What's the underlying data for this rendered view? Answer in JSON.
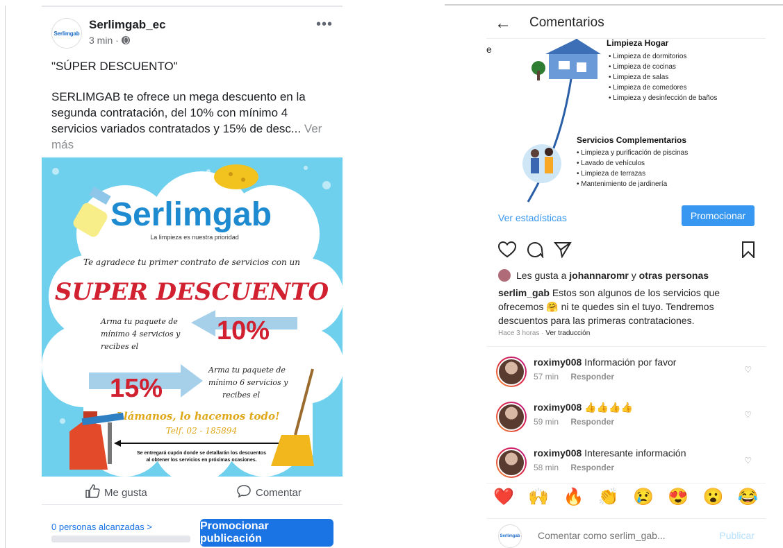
{
  "facebook": {
    "page_name": "Serlimgab_ec",
    "avatar_text": "Serlimgab",
    "time": "3 min ·",
    "more_label": "•••",
    "title": "\"SÚPER DESCUENTO\"",
    "body": "SERLIMGAB te ofrece un mega descuento en la segunda contratación, del 10% con mínimo 4 servicios variados contratados y 15% de desc...",
    "see_more": "Ver más",
    "image": {
      "brand": "Serlimgab",
      "tagline": "La limpieza es nuestra prioridad",
      "thanks": "Te agradece tu primer contrato de servicios con un",
      "headline": "SUPER DESCUENTO",
      "pack1": "Arma tu paquete de mínimo 4 servicios y recibes el",
      "pct1": "10%",
      "pack2": "Arma tu paquete de mínimo 6 servicios y recibes el",
      "pct2": "15%",
      "call": "Llámanos, lo hacemos todo!",
      "phone": "Telf. 02 - 185894",
      "footnote": "Se entregará cupón donde se detallarán los descuentos al obtener los servicios en próximas ocasiones."
    },
    "like_label": "Me gusta",
    "comment_label": "Comentar",
    "reach_label": "0 personas alcanzadas >",
    "promote_label": "Promocionar publicación"
  },
  "instagram": {
    "back": "←",
    "title": "Comentarios",
    "post_image": {
      "edge_char": "e",
      "section1": "Limpieza Hogar",
      "items1": [
        "Limpieza de dormitorios",
        "Limpieza de cocinas",
        "Limpieza de salas",
        "Limpieza de comedores",
        "Limpieza y desinfección de baños"
      ],
      "section2": "Servicios Complementarios",
      "items2": [
        "Limpieza y purificación de piscinas",
        "Lavado de vehículos",
        "Limpieza de terrazas",
        "Mantenimiento de jardinería"
      ]
    },
    "stats_label": "Ver estadísticas",
    "promote_label": "Promocionar",
    "likes_prefix": "Les gusta a",
    "likes_user": "johannaromr",
    "likes_join": "y",
    "likes_others": "otras personas",
    "caption_user": "serlim_gab",
    "caption_text1": "Estos son algunos de los servicios que ofrecemos",
    "caption_emoji": "🤗",
    "caption_text2": "ni te quedes sin el tuyo. Tendremos descuentos para las primeras contrataciones.",
    "time": "Hace 3 horas ·",
    "translate": "Ver traducción",
    "comments": [
      {
        "user": "roximy008",
        "text": "Información por favor",
        "age": "57 min",
        "reply": "Responder"
      },
      {
        "user": "roximy008",
        "text": "👍👍👍👍",
        "age": "59 min",
        "reply": "Responder"
      },
      {
        "user": "roximy008",
        "text": "Interesante información",
        "age": "58 min",
        "reply": "Responder"
      }
    ],
    "emojis": [
      "❤️",
      "🙌",
      "🔥",
      "👏",
      "😢",
      "😍",
      "😮",
      "😂"
    ],
    "compose_avatar": "Serlimgab",
    "compose_placeholder": "Comentar como serlim_gab...",
    "publish_label": "Publicar"
  }
}
